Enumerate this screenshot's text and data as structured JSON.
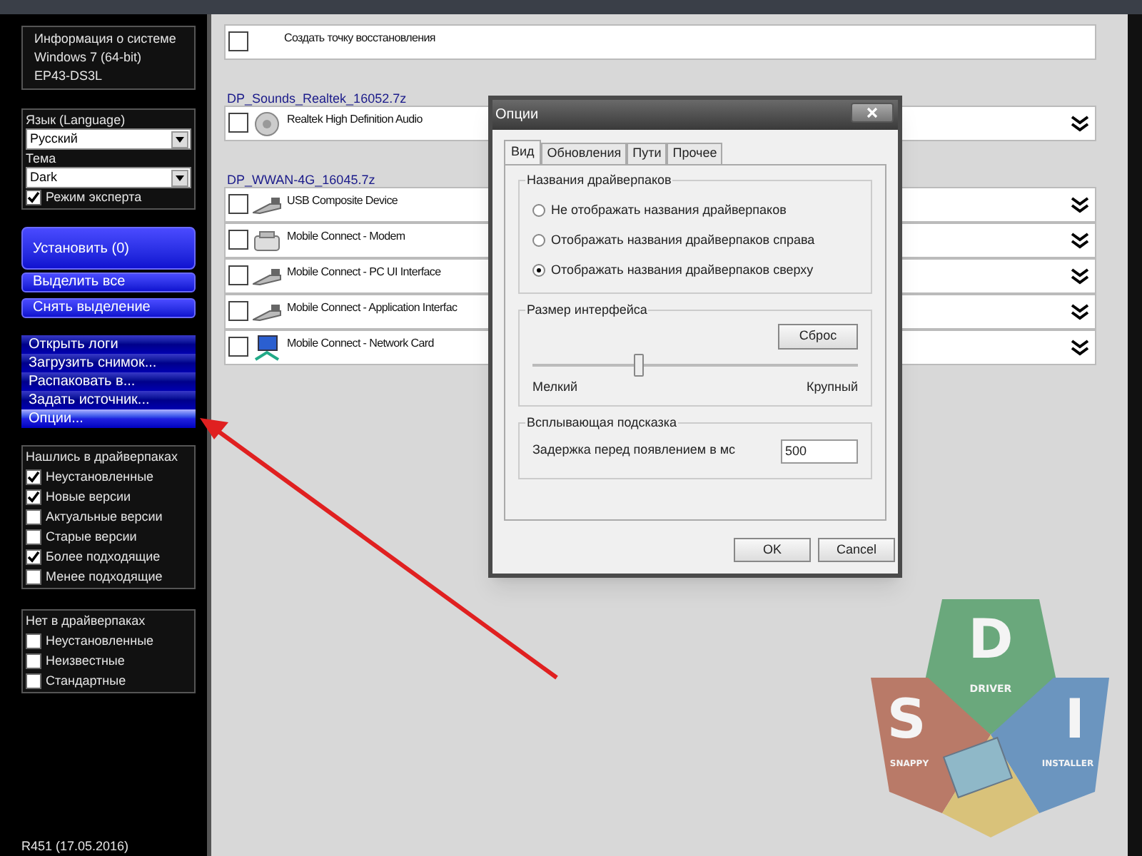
{
  "system_info": [
    "Информация о системе",
    "Windows 7 (64-bit)",
    "EP43-DS3L"
  ],
  "language": {
    "label": "Язык (Language)",
    "value": "Русский"
  },
  "theme": {
    "label": "Тема",
    "value": "Dark"
  },
  "expert_mode": {
    "label": "Режим эксперта",
    "checked": true
  },
  "install_button": "Установить (0)",
  "select_buttons": [
    "Выделить все",
    "Снять выделение"
  ],
  "menu": [
    {
      "label": "Открыть логи",
      "selected": false
    },
    {
      "label": "Загрузить снимок...",
      "selected": false
    },
    {
      "label": "Распаковать в...",
      "selected": false
    },
    {
      "label": "Задать источник...",
      "selected": false
    },
    {
      "label": "Опции...",
      "selected": true
    }
  ],
  "found_filters": {
    "title": "Нашлись в драйверпаках",
    "items": [
      {
        "label": "Неустановленные",
        "checked": true
      },
      {
        "label": "Новые версии",
        "checked": true
      },
      {
        "label": "Актуальные версии",
        "checked": false
      },
      {
        "label": "Старые версии",
        "checked": false
      },
      {
        "label": "Более подходящие",
        "checked": true
      },
      {
        "label": "Менее подходящие",
        "checked": false
      }
    ]
  },
  "missing_filters": {
    "title": "Нет в драйверпаках",
    "items": [
      {
        "label": "Неустановленные",
        "checked": false
      },
      {
        "label": "Неизвестные",
        "checked": false
      },
      {
        "label": "Стандартные",
        "checked": false
      }
    ]
  },
  "version": "R451 (17.05.2016)",
  "restore_point": {
    "label": "Создать точку восстановления",
    "checked": false
  },
  "driver_packs": [
    {
      "name": "DP_Sounds_Realtek_16052.7z",
      "drivers": [
        {
          "name": "Realtek High Definition Audio",
          "checked": false,
          "kind": "audio"
        }
      ]
    },
    {
      "name": "DP_WWAN-4G_16045.7z",
      "drivers": [
        {
          "name": "USB Composite Device",
          "checked": false,
          "kind": "usb"
        },
        {
          "name": "Mobile Connect - Modem",
          "checked": false,
          "kind": "modem"
        },
        {
          "name": "Mobile Connect - PC UI Interface",
          "checked": false,
          "kind": "usb"
        },
        {
          "name": "Mobile Connect - Application Interfac",
          "checked": false,
          "kind": "usb"
        },
        {
          "name": "Mobile Connect - Network Card",
          "checked": false,
          "kind": "network"
        }
      ]
    }
  ],
  "dialog": {
    "title": "Опции",
    "tabs": [
      {
        "label": "Вид",
        "selected": true
      },
      {
        "label": "Обновления",
        "selected": false
      },
      {
        "label": "Пути",
        "selected": false
      },
      {
        "label": "Прочее",
        "selected": false
      }
    ],
    "pack_names": {
      "title": "Названия драйверпаков",
      "options": [
        {
          "label": "Не отображать названия драйверпаков",
          "selected": false
        },
        {
          "label": "Отображать названия драйверпаков справа",
          "selected": false
        },
        {
          "label": "Отображать названия драйверпаков сверху",
          "selected": true
        }
      ]
    },
    "interface_size": {
      "title": "Размер интерфейса",
      "reset": "Сброс",
      "level": 0.33,
      "min_label": "Мелкий",
      "max_label": "Крупный"
    },
    "tooltip": {
      "title": "Всплывающая подсказка",
      "label": "Задержка перед появлением в мс",
      "value": "500"
    },
    "buttons": [
      "OK",
      "Cancel"
    ]
  },
  "logo": {
    "letters": [
      "D",
      "S",
      "I"
    ],
    "words": [
      "DRIVER",
      "SNAPPY",
      "INSTALLER"
    ]
  }
}
